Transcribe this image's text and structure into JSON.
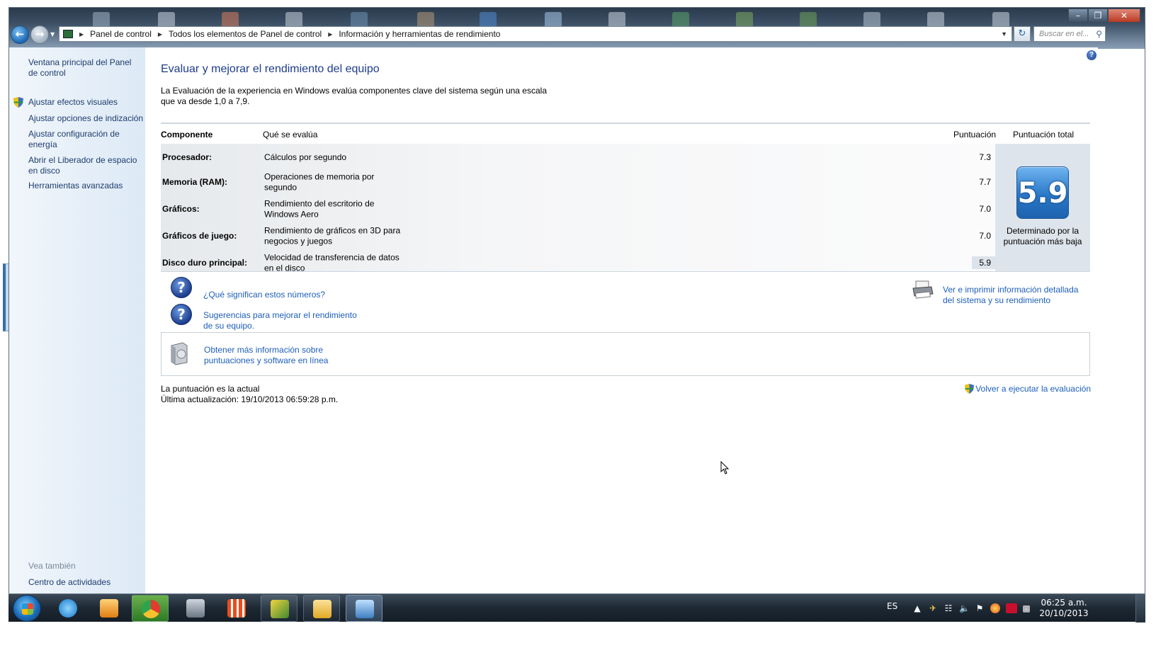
{
  "window": {
    "caption_buttons": [
      "–",
      "❐",
      "✕"
    ]
  },
  "navigation": {
    "back_icon": "back-arrow-icon",
    "forward_icon": "forward-arrow-icon",
    "breadcrumbs": [
      "Panel de control",
      "Todos los elementos de Panel de control",
      "Información y herramientas de rendimiento"
    ],
    "search_placeholder": "Buscar en el..."
  },
  "sidebar": {
    "items": [
      "Ventana principal del Panel de control",
      "Ajustar efectos visuales",
      "Ajustar opciones de indización",
      "Ajustar configuración de energía",
      "Abrir el Liberador de espacio en disco",
      "Herramientas avanzadas"
    ],
    "see_also_label": "Vea también",
    "see_also_items": [
      "Centro de actividades"
    ]
  },
  "main": {
    "title": "Evaluar y mejorar el rendimiento del equipo",
    "intro": "La Evaluación de la experiencia en Windows evalúa componentes clave del sistema según una escala que va desde 1,0 a 7,9.",
    "columns": {
      "component": "Componente",
      "what": "Qué se evalúa",
      "score": "Puntuación",
      "total": "Puntuación total"
    },
    "rows": [
      {
        "component": "Procesador:",
        "what": "Cálculos por segundo",
        "score": "7.3"
      },
      {
        "component": "Memoria (RAM):",
        "what": "Operaciones de memoria por segundo",
        "score": "7.7"
      },
      {
        "component": "Gráficos:",
        "what": "Rendimiento del escritorio de Windows Aero",
        "score": "7.0"
      },
      {
        "component": "Gráficos de juego:",
        "what": "Rendimiento de gráficos en 3D para negocios y juegos",
        "score": "7.0"
      },
      {
        "component": "Disco duro principal:",
        "what": "Velocidad de transferencia de datos en el disco",
        "score": "5.9"
      }
    ],
    "base_score": "5.9",
    "base_score_caption": "Determinado por la puntuación más baja",
    "link_numbers": "¿Qué significan estos números?",
    "link_tips": "Sugerencias para mejorar el rendimiento de su equipo.",
    "link_print": "Ver e imprimir información detallada del sistema y su rendimiento",
    "link_online": "Obtener más información sobre puntuaciones y software en línea",
    "status_current": "La puntuación es la actual",
    "status_updated": "Última actualización: 19/10/2013 06:59:28 p.m.",
    "rerun": "Volver a ejecutar la evaluación",
    "help_icon": "?"
  },
  "taskbar": {
    "language": "ES",
    "time": "06:25 a.m.",
    "date": "20/10/2013"
  },
  "colors": {
    "link": "#1e5fb8",
    "heading": "#1e3c8a",
    "sidebar_link": "#1e3c6e",
    "badge": "#2a78c8"
  }
}
